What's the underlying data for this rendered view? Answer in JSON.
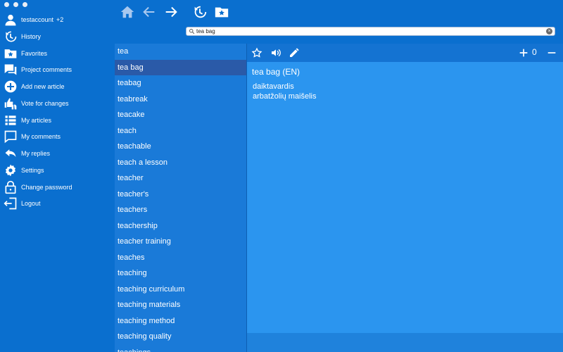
{
  "sidebar": {
    "user": {
      "name": "testaccount",
      "badge": "+2"
    },
    "items": [
      {
        "label": "History",
        "icon": "history-icon"
      },
      {
        "label": "Favorites",
        "icon": "favorites-folder-icon"
      },
      {
        "label": "Project comments",
        "icon": "comments-icon"
      },
      {
        "label": "Add new article",
        "icon": "add-circle-icon"
      },
      {
        "label": "Vote for changes",
        "icon": "thumbs-icon"
      },
      {
        "label": "My articles",
        "icon": "list-icon"
      },
      {
        "label": "My comments",
        "icon": "comment-icon"
      },
      {
        "label": "My replies",
        "icon": "reply-icon"
      },
      {
        "label": "Settings",
        "icon": "gear-icon"
      },
      {
        "label": "Change password",
        "icon": "lock-icon"
      },
      {
        "label": "Logout",
        "icon": "logout-icon"
      }
    ]
  },
  "search": {
    "value": "tea bag",
    "placeholder": ""
  },
  "words": [
    "tea",
    "tea bag",
    "teabag",
    "teabreak",
    "teacake",
    "teach",
    "teachable",
    "teach a lesson",
    "teacher",
    "teacher's",
    "teachers",
    "teachership",
    "teacher training",
    "teaches",
    "teaching",
    "teaching curriculum",
    "teaching materials",
    "teaching method",
    "teaching quality",
    "teachings"
  ],
  "selected_word": "tea bag",
  "entry": {
    "title": "tea bag (EN)",
    "part_of_speech": "daiktavardis",
    "translation": "arbatžolių maišelis",
    "vote_count": "0"
  },
  "colors": {
    "accent": "#0a6fcf",
    "selected": "#2a5aa8",
    "panel": "#2b95ef"
  }
}
